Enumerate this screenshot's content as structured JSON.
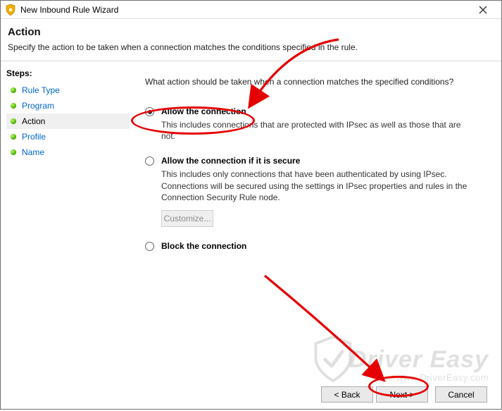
{
  "window": {
    "title": "New Inbound Rule Wizard"
  },
  "header": {
    "title": "Action",
    "subtitle": "Specify the action to be taken when a connection matches the conditions specified in the rule."
  },
  "sidebar": {
    "label": "Steps:",
    "items": [
      {
        "label": "Rule Type",
        "active": false
      },
      {
        "label": "Program",
        "active": false
      },
      {
        "label": "Action",
        "active": true
      },
      {
        "label": "Profile",
        "active": false
      },
      {
        "label": "Name",
        "active": false
      }
    ]
  },
  "main": {
    "prompt": "What action should be taken when a connection matches the specified conditions?",
    "options": [
      {
        "label": "Allow the connection",
        "desc": "This includes connections that are protected with IPsec as well as those that are not.",
        "checked": true
      },
      {
        "label": "Allow the connection if it is secure",
        "desc": "This includes only connections that have been authenticated by using IPsec.  Connections will be secured using the settings in IPsec properties and rules in the Connection Security Rule node.",
        "checked": false,
        "customize": "Customize..."
      },
      {
        "label": "Block the connection",
        "checked": false
      }
    ]
  },
  "footer": {
    "back": "< Back",
    "next": "Next >",
    "cancel": "Cancel"
  },
  "watermark": {
    "line1": "Driver Easy",
    "line2": "www.DriverEasy.com"
  },
  "annotations": {
    "ellipse_allow_color": "#e40000",
    "ellipse_next_color": "#e40000",
    "arrow_color": "#e40000"
  }
}
